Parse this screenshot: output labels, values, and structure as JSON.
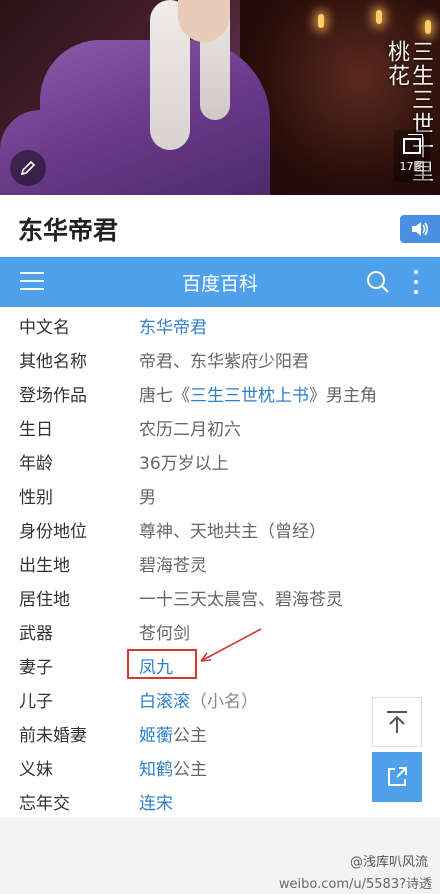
{
  "hero": {
    "gallery_count": "17图",
    "poster_text": "三生三世十里桃花"
  },
  "title": "东华帝君",
  "navbar": {
    "brand": "百度百科"
  },
  "info_rows": [
    {
      "key": "中文名",
      "value": "东华帝君"
    },
    {
      "key": "其他名称",
      "value": "帝君、东华紫府少阳君"
    },
    {
      "key": "登场作品",
      "value_prefix": "唐七《",
      "value_link": "三生三世枕上书",
      "value_suffix": "》男主角"
    },
    {
      "key": "生日",
      "value": "农历二月初六"
    },
    {
      "key": "年龄",
      "value": "36万岁以上"
    },
    {
      "key": "性别",
      "value": "男"
    },
    {
      "key": "身份地位",
      "value": "尊神、天地共主（曾经）"
    },
    {
      "key": "出生地",
      "value": "碧海苍灵"
    },
    {
      "key": "居住地",
      "value": "一十三天太晨宫、碧海苍灵"
    },
    {
      "key": "武器",
      "value": "苍何剑"
    },
    {
      "key": "妻子",
      "value": "凤九"
    },
    {
      "key": "儿子",
      "value_link": "白滚滚",
      "value_suffix": "（小名）"
    },
    {
      "key": "前未婚妻",
      "value_link": "姬蘅",
      "value_suffix": "公主"
    },
    {
      "key": "义妹",
      "value_link": "知鹤",
      "value_suffix": "公主"
    },
    {
      "key": "忘年交",
      "value": "连宋"
    }
  ],
  "watermark": {
    "line1": "@浅库叭风流",
    "line2": "weibo.com/u/5583?诗透"
  },
  "colors": {
    "brand_blue": "#4ea1ea",
    "link_blue": "#2f7fc9",
    "highlight_red": "#d23a3a"
  }
}
